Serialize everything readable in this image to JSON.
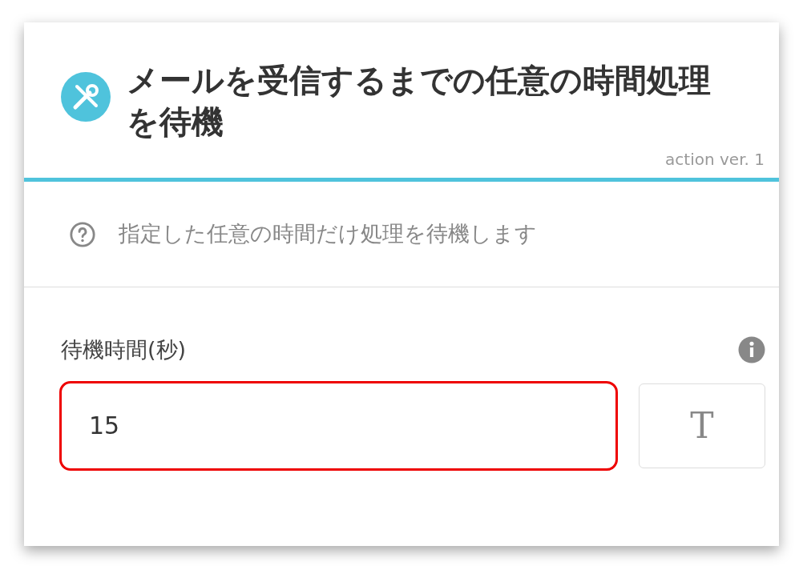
{
  "header": {
    "title": "メールを受信するまでの任意の時間処理を待機",
    "version": "action ver. 1"
  },
  "description": "指定した任意の時間だけ処理を待機します",
  "field": {
    "label": "待機時間(秒)",
    "value": "15",
    "highlighted": true,
    "type_button": "T"
  }
}
